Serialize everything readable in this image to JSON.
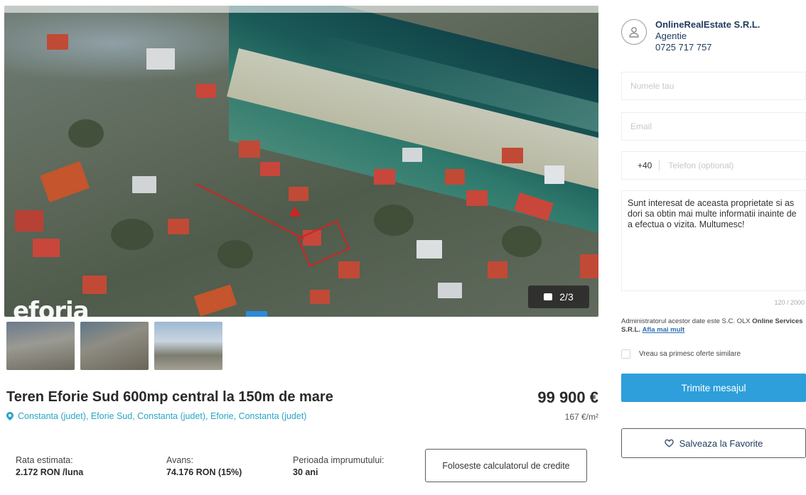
{
  "gallery": {
    "watermark": "eforia",
    "counter": "2/3",
    "thumbnails": [
      "thumb-1",
      "thumb-2",
      "thumb-3"
    ]
  },
  "listing": {
    "title": "Teren Eforie Sud 600mp central la 150m de mare",
    "location": "Constanta (judet), Eforie Sud, Constanta (judet), Eforie, Constanta (judet)",
    "price": "99 900 €",
    "price_per_sqm": "167 €/m²"
  },
  "finance": {
    "rate_label": "Rata estimata:",
    "rate_value": "2.172 RON /luna",
    "advance_label": "Avans:",
    "advance_value": "74.176 RON (15%)",
    "period_label": "Perioada imprumutului:",
    "period_value": "30 ani",
    "calculator_button": "Foloseste calculatorul de credite"
  },
  "agent": {
    "name": "OnlineRealEstate S.R.L.",
    "role": "Agentie",
    "phone": "0725 717 757"
  },
  "contact_form": {
    "name_placeholder": "Numele tau",
    "email_placeholder": "Email",
    "phone_prefix": "+40",
    "phone_placeholder": "Telefon (optional)",
    "message": "Sunt interesat de aceasta proprietate si as dori sa obtin mai multe informatii inainte de a efectua o vizita. Multumesc!",
    "char_count": "120 / 2000",
    "admin_note_prefix": "Administratorul acestor date este S.C. OLX",
    "admin_note_company": "Online Services S.R.L.",
    "admin_note_link": "Afla mai mult",
    "offers_label": "Vreau sa primesc oferte similare",
    "send_button": "Trimite mesajul"
  },
  "favorites_button": "Salveaza la Favorite"
}
